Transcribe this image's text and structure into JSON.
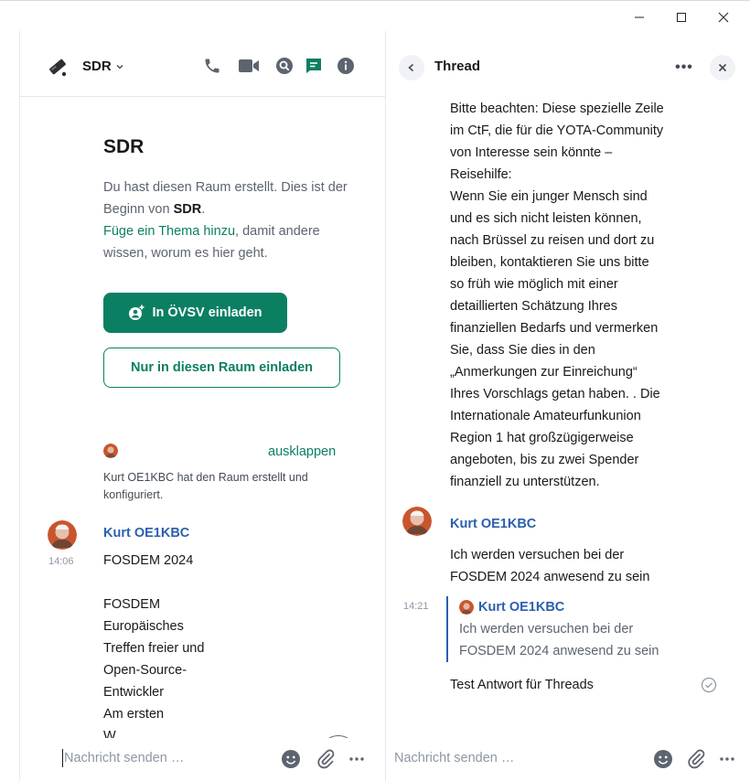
{
  "window": {
    "minimize_glyph": "—",
    "maximize_glyph": "☐",
    "close_glyph": "✕"
  },
  "room": {
    "name": "SDR",
    "header_icons": [
      "phone-icon",
      "video-icon",
      "search-icon",
      "threads-icon",
      "info-icon"
    ],
    "intro": {
      "title": "SDR",
      "created_line_prefix": "Du hast diesen Raum erstellt. Dies ist der Beginn von ",
      "created_line_room": "SDR",
      "created_line_suffix": ".",
      "topic_link": "Füge ein Thema hinzu",
      "topic_suffix": ", damit andere wissen, worum es hier geht."
    },
    "invite_space_button": "In ÖVSV einladen",
    "invite_room_button": "Nur in diesen Raum einladen",
    "expand_link": "ausklappen",
    "created_summary": "Kurt OE1KBC hat den Raum erstellt und konfiguriert.",
    "message": {
      "sender": "Kurt OE1KBC",
      "time": "14:06",
      "lines": [
        "FOSDEM 2024",
        "",
        "FOSDEM",
        "Europäisches",
        "Treffen freier und",
        "Open-Source-",
        "Entwickler",
        "Am ersten",
        "W..."
      ]
    },
    "composer_placeholder": "Nachricht senden …"
  },
  "thread": {
    "title": "Thread",
    "more_label": "•••",
    "body_lines": [
      "Bitte beachten: Diese spezielle Zeile",
      "im CtF, die für die YOTA-Community",
      "von Interesse sein könnte –",
      "Reisehilfe:",
      "Wenn Sie ein junger Mensch sind",
      "und es sich nicht leisten können,",
      "nach Brüssel zu reisen und dort zu",
      "bleiben, kontaktieren Sie uns bitte",
      "so früh wie möglich mit einer",
      "detaillierten Schätzung Ihres",
      "finanziellen Bedarfs und vermerken",
      "Sie, dass Sie dies in den",
      "„Anmerkungen zur Einreichung“",
      "Ihres Vorschlags getan haben. . Die",
      "Internationale Amateurfunkunion",
      "Region 1 hat großzügigerweise",
      "angeboten, bis zu zwei Spender",
      "finanziell zu unterstützen."
    ],
    "reply": {
      "sender": "Kurt OE1KBC",
      "text_line1": "Ich werden versuchen bei der",
      "text_line2": "FOSDEM 2024 anwesend zu sein",
      "time": "14:21",
      "quote_sender": "Kurt OE1KBC",
      "quote_line1": "Ich werden versuchen bei der",
      "quote_line2": "FOSDEM 2024 anwesend zu sein",
      "answer": "Test Antwort für Threads"
    },
    "composer_placeholder": "Nachricht senden …"
  },
  "colors": {
    "accent": "#0b7f62",
    "sender": "#2b5fae",
    "muted": "#5c6470"
  }
}
